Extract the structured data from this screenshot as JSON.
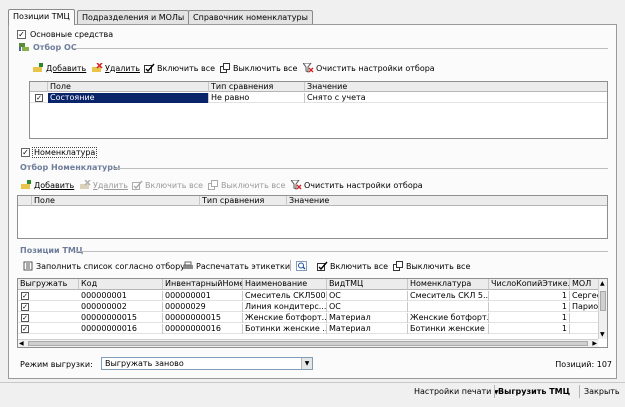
{
  "tabs": [
    {
      "label": "Позиции ТМЦ",
      "active": true
    },
    {
      "label": "Подразделения и МОЛы",
      "active": false
    },
    {
      "label": "Справочник номенклатуры",
      "active": false
    }
  ],
  "fixed_assets": {
    "checkbox_label": "Основные средства",
    "checked": true,
    "filter_title": "Отбор ОС",
    "toolbar": {
      "add": "Добавить",
      "delete": "Удалить",
      "enable_all": "Включить все",
      "disable_all": "Выключить все",
      "clear": "Очистить настройки отбора"
    },
    "columns": [
      "Поле",
      "Тип сравнения",
      "Значение"
    ],
    "rows": [
      {
        "checked": true,
        "field": "Состояние",
        "comparison": "Не равно",
        "value": "Снято с учета"
      }
    ]
  },
  "nomenclature": {
    "checkbox_label": "Номенклатура",
    "checked": true,
    "filter_title": "Отбор Номенклатуры",
    "toolbar": {
      "add": "Добавить",
      "delete": "Удалить",
      "enable_all": "Включить все",
      "disable_all": "Выключить все",
      "clear": "Очистить настройки отбора"
    },
    "columns": [
      "Поле",
      "Тип сравнения",
      "Значение"
    ]
  },
  "items": {
    "title": "Позиции ТМЦ",
    "toolbar": {
      "fill": "Заполнить список согласно отбору",
      "print": "Распечатать этикетки",
      "enable_all": "Включить все",
      "disable_all": "Выключить все"
    },
    "columns": [
      "Выгружать",
      "Код",
      "ИнвентарныйНомер",
      "Наименование",
      "ВидТМЦ",
      "Номенклатура",
      "ЧислоКопийЭтике...",
      "МОЛ"
    ],
    "rows": [
      {
        "checked": true,
        "code": "000000001",
        "inv": "000000001",
        "name": "Смеситель СКЛ500",
        "kind": "ОС",
        "nom": "Смеситель СКЛ 5...",
        "copies": "1",
        "mol": "Сергее"
      },
      {
        "checked": true,
        "code": "000000002",
        "inv": "00000029",
        "name": "Линия кондитерс...",
        "kind": "ОС",
        "nom": "",
        "copies": "1",
        "mol": "Парион"
      },
      {
        "checked": true,
        "code": "00000000015",
        "inv": "00000000015",
        "name": "Женские ботфорт...",
        "kind": "Материал",
        "nom": "Женские ботфорт...",
        "copies": "1",
        "mol": ""
      },
      {
        "checked": true,
        "code": "00000000016",
        "inv": "00000000016",
        "name": "Ботинки женские ...",
        "kind": "Материал",
        "nom": "Ботинки женские ...",
        "copies": "1",
        "mol": ""
      }
    ]
  },
  "export_mode": {
    "label": "Режим выгрузки:",
    "value": "Выгружать заново"
  },
  "positions": "Позиций: 107",
  "footer": {
    "print_settings": "Настройки печати",
    "upload": "Выгрузить ТМЦ",
    "close": "Закрыть"
  },
  "colors": {
    "selection": "#0a246a",
    "section_title": "#6e7e9b"
  }
}
